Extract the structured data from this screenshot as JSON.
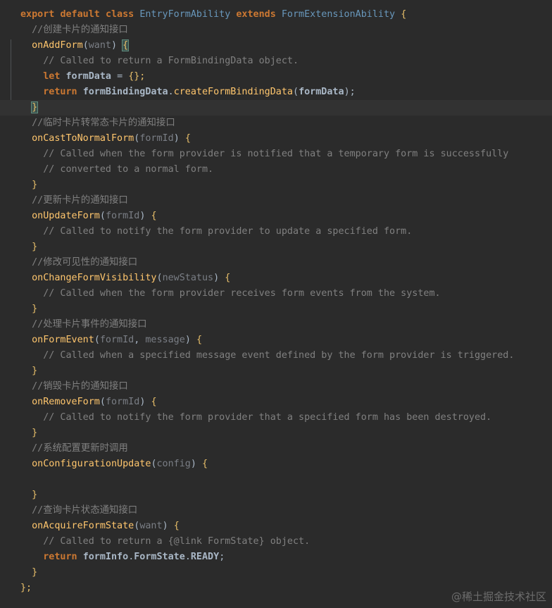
{
  "code": {
    "line01": {
      "kw1": "export",
      "kw2": "default",
      "kw3": "class",
      "cls1": "EntryFormAbility",
      "kw4": "extends",
      "cls2": "FormExtensionAbility",
      "brace": "{"
    },
    "line02": {
      "comment": "//创建卡片的通知接口"
    },
    "line03": {
      "fn": "onAddForm",
      "lp": "(",
      "param": "want",
      "rp": ")",
      "brace": "{"
    },
    "line04": {
      "comment": "// Called to return a FormBindingData object."
    },
    "line05": {
      "kw": "let",
      "var": "formData",
      "op": "=",
      "value": "{};"
    },
    "line06": {
      "kw": "return",
      "obj": "formBindingData",
      "dot": ".",
      "method": "createFormBindingData",
      "lp": "(",
      "arg": "formData",
      "end": ");"
    },
    "line07": {
      "brace": "}"
    },
    "line08": {
      "comment": "//临时卡片转常态卡片的通知接口"
    },
    "line09": {
      "fn": "onCastToNormalForm",
      "lp": "(",
      "param": "formId",
      "rp": ")",
      "brace": "{"
    },
    "line10": {
      "comment": "// Called when the form provider is notified that a temporary form is successfully"
    },
    "line11": {
      "comment": "// converted to a normal form."
    },
    "line12": {
      "brace": "}"
    },
    "line13": {
      "comment": "//更新卡片的通知接口"
    },
    "line14": {
      "fn": "onUpdateForm",
      "lp": "(",
      "param": "formId",
      "rp": ")",
      "brace": "{"
    },
    "line15": {
      "comment": "// Called to notify the form provider to update a specified form."
    },
    "line16": {
      "brace": "}"
    },
    "line17": {
      "comment": "//修改可见性的通知接口"
    },
    "line18": {
      "fn": "onChangeFormVisibility",
      "lp": "(",
      "param": "newStatus",
      "rp": ")",
      "brace": "{"
    },
    "line19": {
      "comment": "// Called when the form provider receives form events from the system."
    },
    "line20": {
      "brace": "}"
    },
    "line21": {
      "comment": "//处理卡片事件的通知接口"
    },
    "line22": {
      "fn": "onFormEvent",
      "lp": "(",
      "param1": "formId",
      "sep": ", ",
      "param2": "message",
      "rp": ")",
      "brace": "{"
    },
    "line23": {
      "comment": "// Called when a specified message event defined by the form provider is triggered."
    },
    "line24": {
      "brace": "}"
    },
    "line25": {
      "comment": "//销毁卡片的通知接口"
    },
    "line26": {
      "fn": "onRemoveForm",
      "lp": "(",
      "param": "formId",
      "rp": ")",
      "brace": "{"
    },
    "line27": {
      "comment": "// Called to notify the form provider that a specified form has been destroyed."
    },
    "line28": {
      "brace": "}"
    },
    "line29": {
      "comment": "//系统配置更新时调用"
    },
    "line30": {
      "fn": "onConfigurationUpdate",
      "lp": "(",
      "param": "config",
      "rp": ")",
      "brace": "{"
    },
    "line31": {},
    "line32": {
      "brace": "}"
    },
    "line33": {
      "comment": "//查询卡片状态通知接口"
    },
    "line34": {
      "fn": "onAcquireFormState",
      "lp": "(",
      "param": "want",
      "rp": ")",
      "brace": "{"
    },
    "line35": {
      "comment": "// Called to return a {@link FormState} object."
    },
    "line36": {
      "kw": "return",
      "obj": "formInfo",
      "dot1": ".",
      "prop1": "FormState",
      "dot2": ".",
      "prop2": "READY",
      "end": ";"
    },
    "line37": {
      "brace": "}"
    },
    "line38": {
      "end": "};"
    }
  },
  "watermark": "@稀土掘金技术社区",
  "colors": {
    "background": "#2b2b2b",
    "keyword": "#cc7832",
    "function": "#ffc66d",
    "comment": "#808080",
    "parameter": "#7a7e85",
    "class": "#6897bb"
  }
}
